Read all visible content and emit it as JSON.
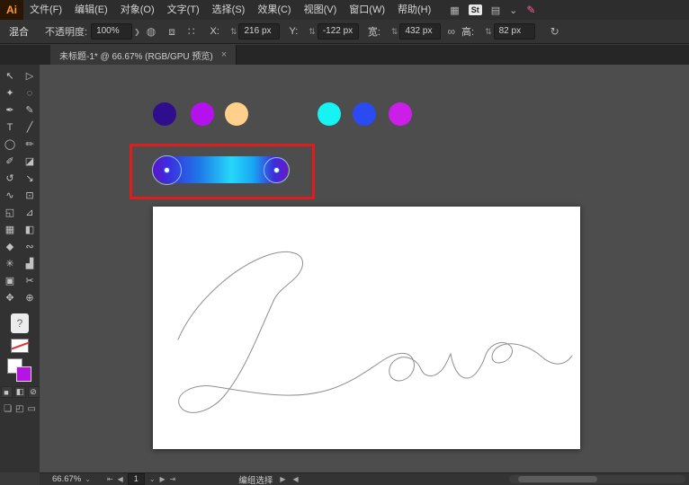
{
  "menubar": {
    "logo": "Ai",
    "items": [
      "文件(F)",
      "编辑(E)",
      "对象(O)",
      "文字(T)",
      "选择(S)",
      "效果(C)",
      "视图(V)",
      "窗口(W)",
      "帮助(H)"
    ],
    "right_icons": {
      "arrange": "▦",
      "stock_badge": "St",
      "workspace": "▤",
      "chevron": "⌄",
      "share_brush": "✎"
    }
  },
  "control_bar": {
    "mode_label": "混合",
    "opacity_label": "不透明度:",
    "opacity_value": "100%",
    "icons": {
      "stepper": "⇅",
      "chevron": "❯",
      "recolor": "◍",
      "pattern": "⧈",
      "grid": "∷",
      "link": "∞",
      "transform": "↻"
    },
    "fields": [
      {
        "label": "X:",
        "value": "216 px"
      },
      {
        "label": "Y:",
        "value": "-122 px"
      },
      {
        "label": "宽:",
        "value": "432 px"
      },
      {
        "label": "高:",
        "value": "82 px"
      }
    ]
  },
  "tab": {
    "title": "未标题-1* @ 66.67% (RGB/GPU 预览)",
    "close_icon": "×"
  },
  "toolbar": {
    "tools": [
      {
        "name": "selection-tool",
        "glyph": "↖"
      },
      {
        "name": "direct-selection-tool",
        "glyph": "▷"
      },
      {
        "name": "magic-wand-tool",
        "glyph": "✦"
      },
      {
        "name": "lasso-tool",
        "glyph": "◌"
      },
      {
        "name": "pen-tool",
        "glyph": "✒"
      },
      {
        "name": "curvature-tool",
        "glyph": "✎"
      },
      {
        "name": "type-tool",
        "glyph": "T"
      },
      {
        "name": "line-segment-tool",
        "glyph": "╱"
      },
      {
        "name": "ellipse-tool",
        "glyph": "◯"
      },
      {
        "name": "paintbrush-tool",
        "glyph": "✏"
      },
      {
        "name": "pencil-tool",
        "glyph": "✐"
      },
      {
        "name": "eraser-tool",
        "glyph": "◪"
      },
      {
        "name": "rotate-tool",
        "glyph": "↺"
      },
      {
        "name": "scale-tool",
        "glyph": "↘"
      },
      {
        "name": "width-tool",
        "glyph": "∿"
      },
      {
        "name": "free-transform-tool",
        "glyph": "⊡"
      },
      {
        "name": "shape-builder-tool",
        "glyph": "◱"
      },
      {
        "name": "perspective-grid-tool",
        "glyph": "⊿"
      },
      {
        "name": "mesh-tool",
        "glyph": "▦"
      },
      {
        "name": "gradient-tool",
        "glyph": "◧"
      },
      {
        "name": "eyedropper-tool",
        "glyph": "◆"
      },
      {
        "name": "blend-tool",
        "glyph": "∾"
      },
      {
        "name": "symbol-sprayer-tool",
        "glyph": "✳"
      },
      {
        "name": "column-graph-tool",
        "glyph": "▟"
      },
      {
        "name": "artboard-tool",
        "glyph": "▣"
      },
      {
        "name": "slice-tool",
        "glyph": "✂"
      },
      {
        "name": "hand-tool",
        "glyph": "✥"
      },
      {
        "name": "zoom-tool",
        "glyph": "⊕"
      }
    ],
    "help_label": "?",
    "stroke_swatch_color": "#b514e4",
    "mini_buttons": [
      {
        "name": "color-button",
        "glyph": "■"
      },
      {
        "name": "gradient-button",
        "glyph": "◧"
      },
      {
        "name": "none-button",
        "glyph": "⊘"
      }
    ],
    "bottom_icons": [
      {
        "name": "draw-normal-icon",
        "glyph": "❏"
      },
      {
        "name": "draw-inside-icon",
        "glyph": "◰"
      },
      {
        "name": "screen-mode-icon",
        "glyph": "▭"
      }
    ]
  },
  "canvas": {
    "swatches": [
      {
        "name": "swatch-indigo",
        "color": "#2f0e8e"
      },
      {
        "name": "swatch-purple",
        "color": "#b511ef"
      },
      {
        "name": "swatch-peach",
        "color": "#ffd08c"
      },
      {
        "name": "swatch-cyan",
        "color": "#17f3f3"
      },
      {
        "name": "swatch-blue",
        "color": "#2b4bf2"
      },
      {
        "name": "swatch-magenta",
        "color": "#cb1fe9"
      }
    ],
    "blend": {
      "stops": [
        "#5a14c8 0%",
        "#3a30e0 12%",
        "#1e7ae8 35%",
        "#26d8fa 58%",
        "#18a8f2 74%",
        "#3d2cd8 90%",
        "#6a18d0 100%"
      ],
      "highlight_color": "#e11c1c"
    },
    "artboard": {
      "text": "Love"
    }
  },
  "statusbar": {
    "zoom": "66.67%",
    "chevron": "⌄",
    "nav": {
      "first": "⇤",
      "prev": "◀",
      "page": "1",
      "page_chevron": "⌄",
      "next": "▶",
      "last": "⇥"
    },
    "tool_label": "编组选择",
    "arrow_right": "▶",
    "arrow_left": "◀"
  }
}
